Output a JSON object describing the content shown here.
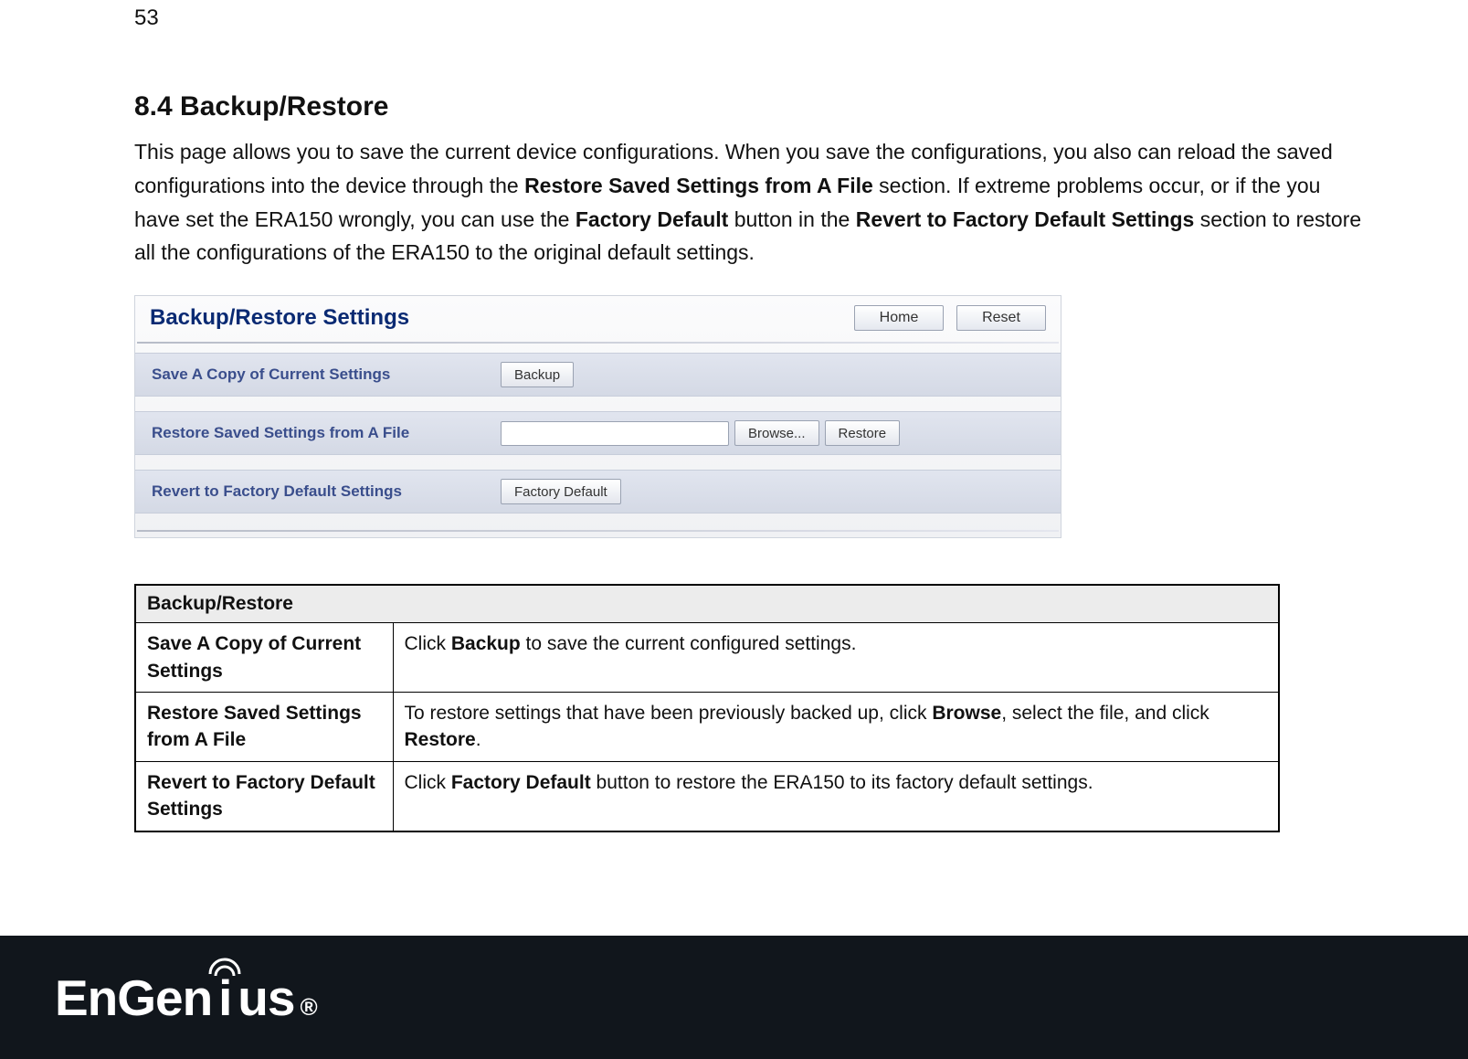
{
  "page_number": "53",
  "heading": "8.4   Backup/Restore",
  "intro": {
    "t1": "This page allows you to save the current device configurations. When you save the configurations, you also can reload the saved configurations into the device through the ",
    "b1": "Restore Saved Settings from A File",
    "t2": " section. If extreme problems occur, or if the you have set the ERA150 wrongly, you can use the ",
    "b2": "Factory Default",
    "t3": " button in the ",
    "b3": "Revert to Factory Default Settings",
    "t4": " section to restore all the configurations of the ERA150 to the original default settings."
  },
  "panel": {
    "title": "Backup/Restore Settings",
    "home_btn": "Home",
    "reset_btn": "Reset",
    "rows": [
      {
        "label": "Save A Copy of Current Settings",
        "backup_btn": "Backup"
      },
      {
        "label": "Restore Saved Settings from A File",
        "browse_btn": "Browse...",
        "restore_btn": "Restore",
        "file_value": ""
      },
      {
        "label": "Revert to Factory Default Settings",
        "factory_btn": "Factory Default"
      }
    ]
  },
  "table": {
    "header": "Backup/Restore",
    "rows": [
      {
        "key": "Save A Copy of Current Settings",
        "v_t1": "Click ",
        "v_b1": "Backup",
        "v_t2": " to save the current configured settings."
      },
      {
        "key": "Restore Saved Settings from A File",
        "v_t1": "To restore settings that have been previously backed up, click ",
        "v_b1": "Browse",
        "v_t2": ", select the file, and click ",
        "v_b2": "Restore",
        "v_t3": "."
      },
      {
        "key": "Revert to Factory Default Settings",
        "v_t1": "Click ",
        "v_b1": "Factory Default",
        "v_t2": " button to restore the ERA150 to its factory default settings."
      }
    ]
  },
  "logo": {
    "part1": "EnGen",
    "part2": "us",
    "reg": "®"
  }
}
